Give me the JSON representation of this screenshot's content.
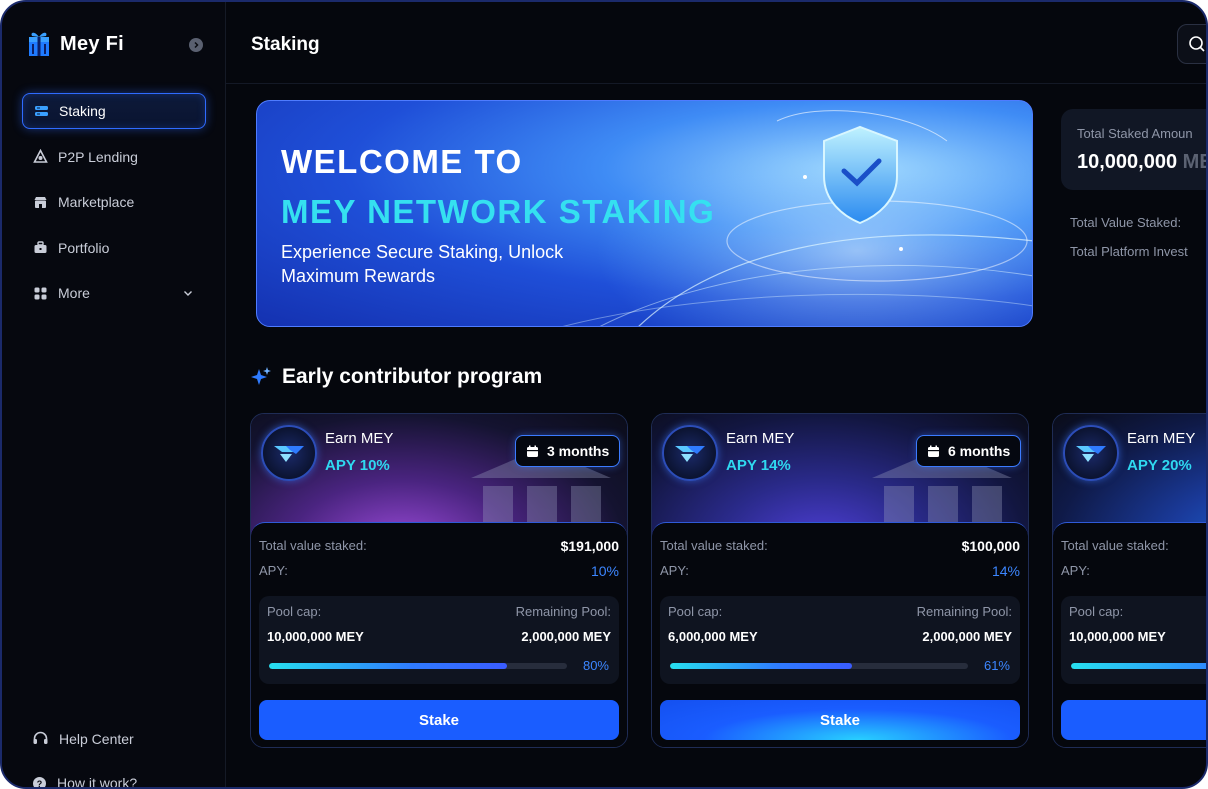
{
  "app": {
    "brand": "Mey Fi"
  },
  "sidebar": {
    "items": [
      {
        "label": "Staking",
        "icon": "layers-icon",
        "active": true
      },
      {
        "label": "P2P Lending",
        "icon": "triangle-network-icon"
      },
      {
        "label": "Marketplace",
        "icon": "store-icon"
      },
      {
        "label": "Portfolio",
        "icon": "briefcase-icon"
      },
      {
        "label": "More",
        "icon": "grid-icon"
      }
    ],
    "help": "Help Center",
    "howit": "How it work?"
  },
  "header": {
    "title": "Staking"
  },
  "banner": {
    "line1": "WELCOME TO",
    "line2": "MEY NETWORK STAKING",
    "subtitle": "Experience Secure Staking, Unlock Maximum Rewards"
  },
  "stats": {
    "total_staked_label": "Total Staked Amoun",
    "total_staked_value": "10,000,000",
    "total_staked_unit": "ME",
    "total_value_label": "Total Value Staked:",
    "platform_label": "Total Platform Invest"
  },
  "section": {
    "title": "Early contributor program"
  },
  "pools": [
    {
      "earn": "Earn MEY",
      "apy_head": "APY 10%",
      "duration": "3 months",
      "tvs_label": "Total value staked:",
      "tvs": "$191,000",
      "apy_label": "APY:",
      "apy": "10%",
      "cap_label": "Pool cap:",
      "cap": "10,000,000 MEY",
      "remain_label": "Remaining Pool:",
      "remain": "2,000,000 MEY",
      "progress": 80,
      "progress_label": "80%",
      "button": "Stake"
    },
    {
      "earn": "Earn MEY",
      "apy_head": "APY 14%",
      "duration": "6 months",
      "tvs_label": "Total value staked:",
      "tvs": "$100,000",
      "apy_label": "APY:",
      "apy": "14%",
      "cap_label": "Pool cap:",
      "cap": "6,000,000 MEY",
      "remain_label": "Remaining Pool:",
      "remain": "2,000,000 MEY",
      "progress": 61,
      "progress_label": "61%",
      "button": "Stake"
    },
    {
      "earn": "Earn MEY",
      "apy_head": "APY 20%",
      "duration": "",
      "tvs_label": "Total value staked:",
      "tvs": "",
      "apy_label": "APY:",
      "apy": "",
      "cap_label": "Pool cap:",
      "cap": "10,000,000 MEY",
      "remain_label": "",
      "remain": "",
      "progress": 90,
      "progress_label": "",
      "button": ""
    }
  ],
  "colors": {
    "accent": "#1a5dff",
    "cyan": "#2fd8f0",
    "background": "#05070d"
  }
}
